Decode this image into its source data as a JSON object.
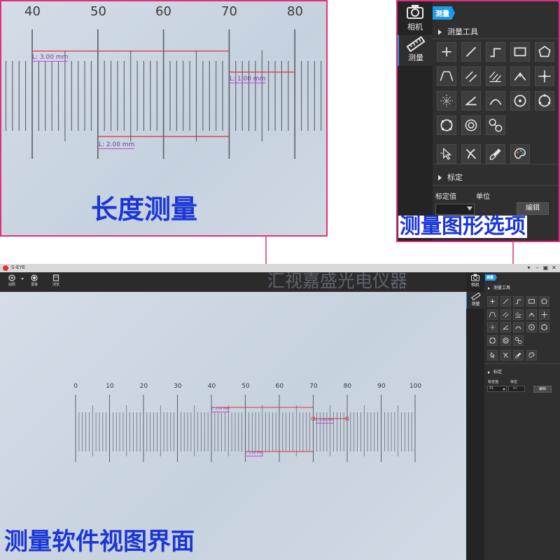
{
  "captions": {
    "length": "长度测量",
    "shape_options": "测量图形选项",
    "software_view": "测量软件视图界面",
    "watermark": "汇视嘉盛光电仪器"
  },
  "zoom_ruler": {
    "ticks": [
      "40",
      "50",
      "60",
      "70",
      "80"
    ],
    "measurements": [
      "L: 3.00 mm",
      "L: 1.00 mm",
      "L: 2.00 mm"
    ]
  },
  "panel": {
    "camera_label": "相机",
    "measure_label": "测量",
    "active_tag": "测量",
    "tools_header": "测量工具",
    "calibration_header": "标定",
    "cal_value_label": "标定值",
    "unit_label": "单位",
    "edit_button": "编辑",
    "cal_value": "01",
    "unit_value": "m"
  },
  "app": {
    "title": "S-EYE",
    "toolbar": {
      "capture_label": "拍照",
      "record_label": "录像",
      "browse_label": "浏览"
    },
    "window_controls": [
      "▾",
      "–",
      "▣",
      "✕"
    ]
  },
  "main_ruler": {
    "ticks": [
      "0",
      "10",
      "20",
      "30",
      "40",
      "50",
      "60",
      "70",
      "80",
      "90",
      "100"
    ],
    "measurements": [
      "L: 3.00 mm",
      "L: 1.00 mm",
      "L: 2.00 mm"
    ]
  },
  "tool_icons": [
    "crosshair-point-icon",
    "line-icon",
    "polyline-icon",
    "rectangle-icon",
    "polygon-icon",
    "angle-lines-icon",
    "parallel-lines-icon",
    "multi-parallel-icon",
    "angle-vertex-icon",
    "cross-center-icon",
    "grid-points-icon",
    "angle-icon",
    "arc-icon",
    "circle-center-icon",
    "three-point-circle-icon",
    "circle-points-icon",
    "concentric-circle-icon",
    "circle-distance-icon",
    "select-move-icon",
    "delete-icon",
    "clear-brush-icon",
    "palette-icon"
  ],
  "colors": {
    "panel_bg": "#2f2f2f",
    "accent": "#1e9be8",
    "border_magenta": "#e0307a",
    "measure_red": "#e03030",
    "caption_blue": "#1b36d6",
    "photo_bg": "#c9d5e3"
  }
}
